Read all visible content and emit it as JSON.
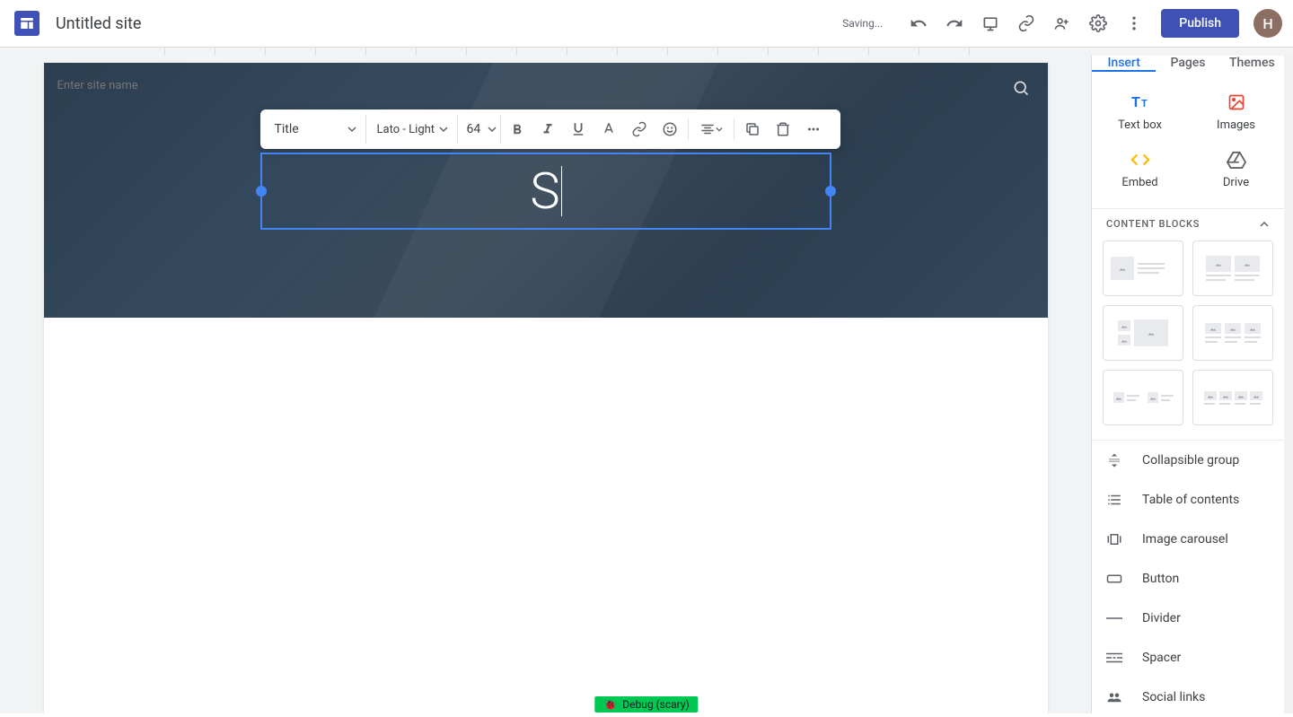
{
  "header": {
    "doc_title": "Untitled site",
    "saving": "Saving...",
    "publish": "Publish",
    "avatar_letter": "H"
  },
  "hero": {
    "site_name_placeholder": "Enter site name",
    "title_value": "S"
  },
  "toolbar": {
    "style": "Title",
    "font": "Lato - Light",
    "size": "64"
  },
  "sidebar": {
    "tabs": [
      "Insert",
      "Pages",
      "Themes"
    ],
    "active_tab": 0,
    "insert_items": {
      "text_box": "Text box",
      "images": "Images",
      "embed": "Embed",
      "drive": "Drive"
    },
    "content_blocks_header": "CONTENT BLOCKS",
    "list": {
      "collapsible": "Collapsible group",
      "toc": "Table of contents",
      "carousel": "Image carousel",
      "button": "Button",
      "divider": "Divider",
      "spacer": "Spacer",
      "social": "Social links"
    }
  },
  "debug": "Debug (scary)"
}
